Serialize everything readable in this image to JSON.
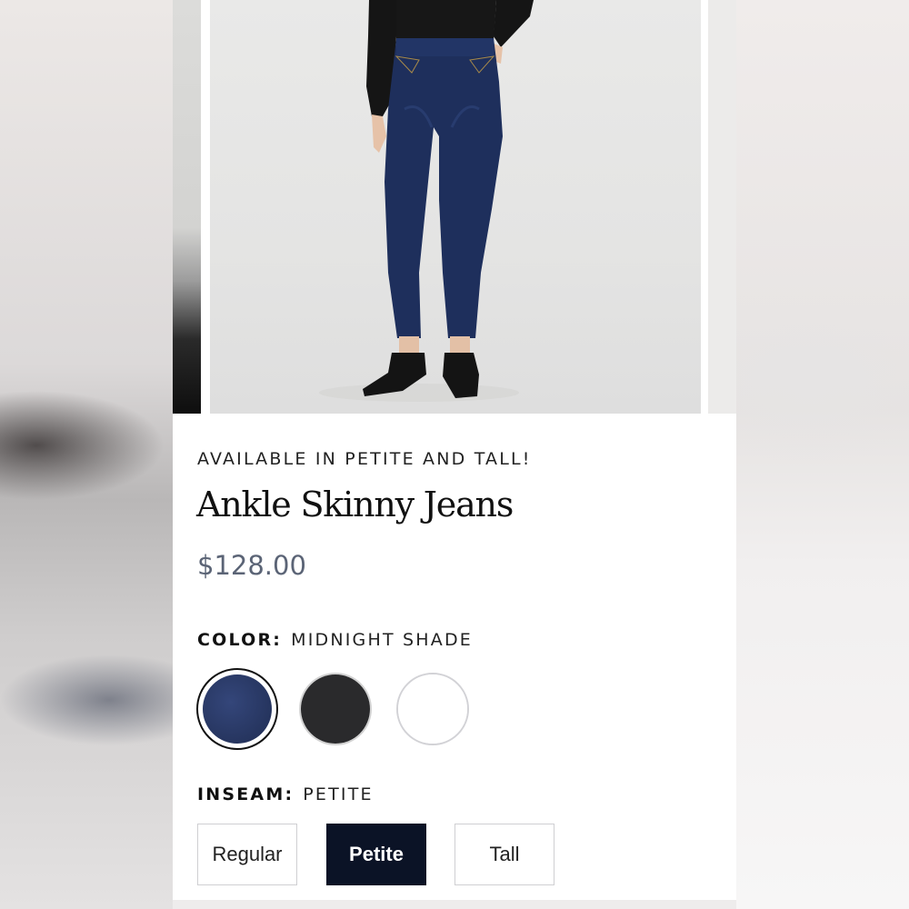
{
  "product": {
    "eyebrow": "AVAILABLE IN PETITE AND TALL!",
    "title": "Ankle Skinny Jeans",
    "price": "$128.00",
    "image_alt": "model-wearing-ankle-skinny-jeans"
  },
  "color_option": {
    "label": "COLOR:",
    "selected": "MIDNIGHT SHADE",
    "swatches": [
      {
        "name": "Midnight Shade",
        "hex": "#2c3a62",
        "selected": true
      },
      {
        "name": "Black",
        "hex": "#2a2a2c",
        "selected": false
      },
      {
        "name": "White",
        "hex": "#ffffff",
        "selected": false
      }
    ]
  },
  "inseam_option": {
    "label": "INSEAM:",
    "selected": "PETITE",
    "buttons": [
      {
        "label": "Regular",
        "active": false
      },
      {
        "label": "Petite",
        "active": true
      },
      {
        "label": "Tall",
        "active": false
      }
    ]
  },
  "colors": {
    "price_text": "#5b6476",
    "active_button": "#0b1326"
  }
}
